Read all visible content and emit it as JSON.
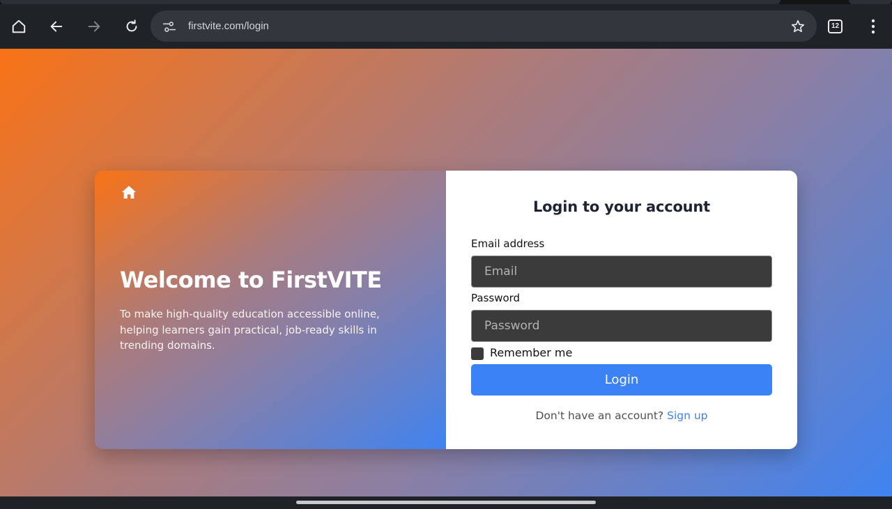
{
  "browser": {
    "url": "firstvite.com/login",
    "tab_count": "12",
    "icons": {
      "home": "home-icon",
      "back": "arrow-left-icon",
      "forward": "arrow-right-icon",
      "reload": "reload-icon",
      "site_info": "tune-icon",
      "bookmark": "star-icon",
      "menu": "kebab-menu-icon"
    }
  },
  "welcome": {
    "title": "Welcome to FirstVITE",
    "description": "To make high-quality education accessible online, helping learners gain practical, job-ready skills in trending domains."
  },
  "login_form": {
    "title": "Login to your account",
    "email_label": "Email address",
    "email_placeholder": "Email",
    "email_value": "",
    "password_label": "Password",
    "password_placeholder": "Password",
    "password_value": "",
    "remember_label": "Remember me",
    "remember_checked": false,
    "submit_label": "Login",
    "signup_prompt": "Don't have an account?",
    "signup_link": "Sign up"
  },
  "colors": {
    "accent_blue": "#3b82f6",
    "gradient_orange": "#f97316",
    "input_bg": "#3b3b3b",
    "chrome_bg": "#1f2328"
  }
}
